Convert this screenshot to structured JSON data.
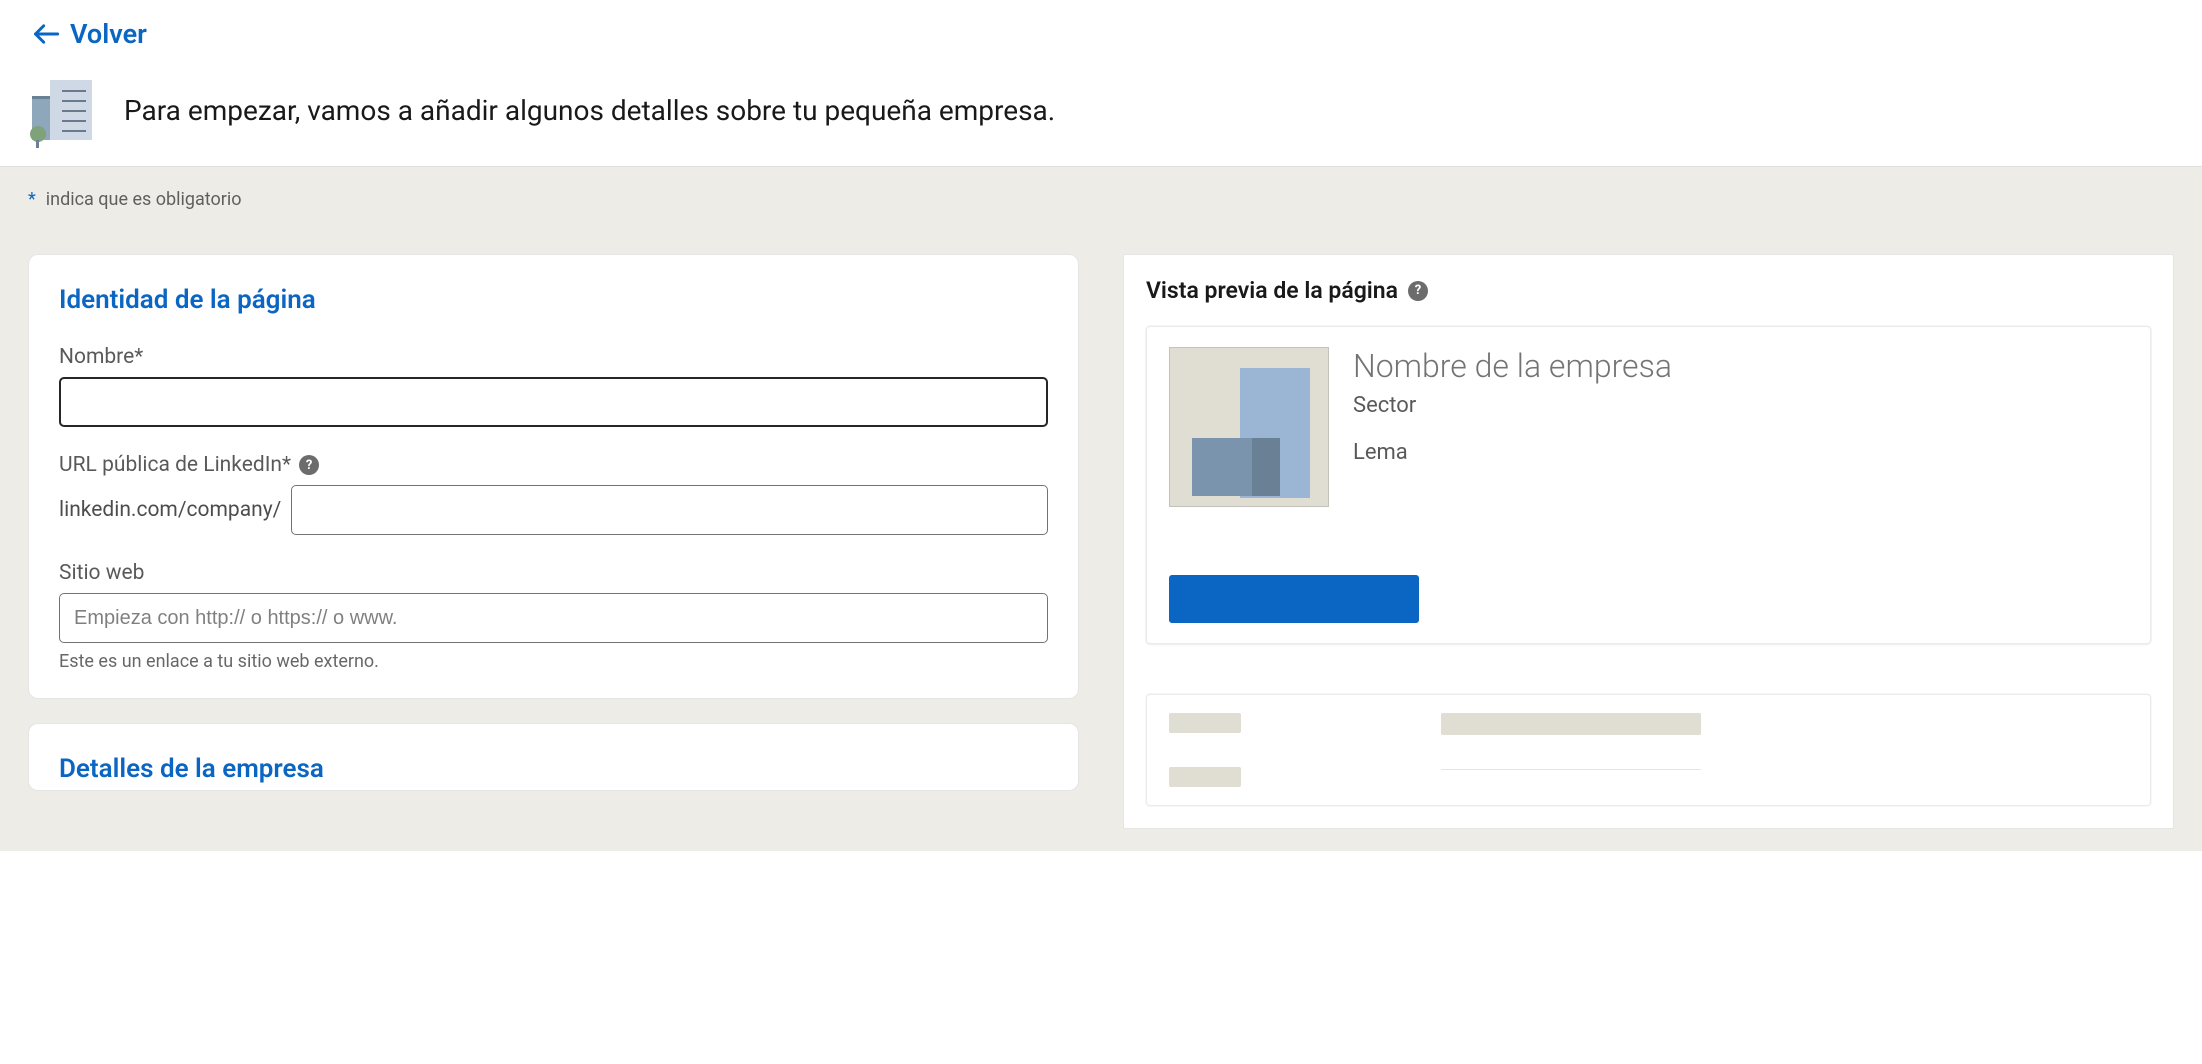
{
  "header": {
    "back_label": "Volver",
    "intro_text": "Para empezar, vamos a añadir algunos detalles sobre tu pequeña empresa."
  },
  "required_note": "indica que es obligatorio",
  "form": {
    "identity": {
      "title": "Identidad de la página",
      "name_label": "Nombre*",
      "name_value": "",
      "url_label": "URL pública de LinkedIn*",
      "url_prefix": "linkedin.com/company/",
      "url_value": "",
      "website_label": "Sitio web",
      "website_placeholder": "Empieza con http:// o https:// o www.",
      "website_value": "",
      "website_help": "Este es un enlace a tu sitio web externo."
    },
    "details": {
      "title": "Detalles de la empresa"
    }
  },
  "preview": {
    "header": "Vista previa de la página",
    "company_name": "Nombre de la empresa",
    "sector": "Sector",
    "tagline": "Lema"
  }
}
